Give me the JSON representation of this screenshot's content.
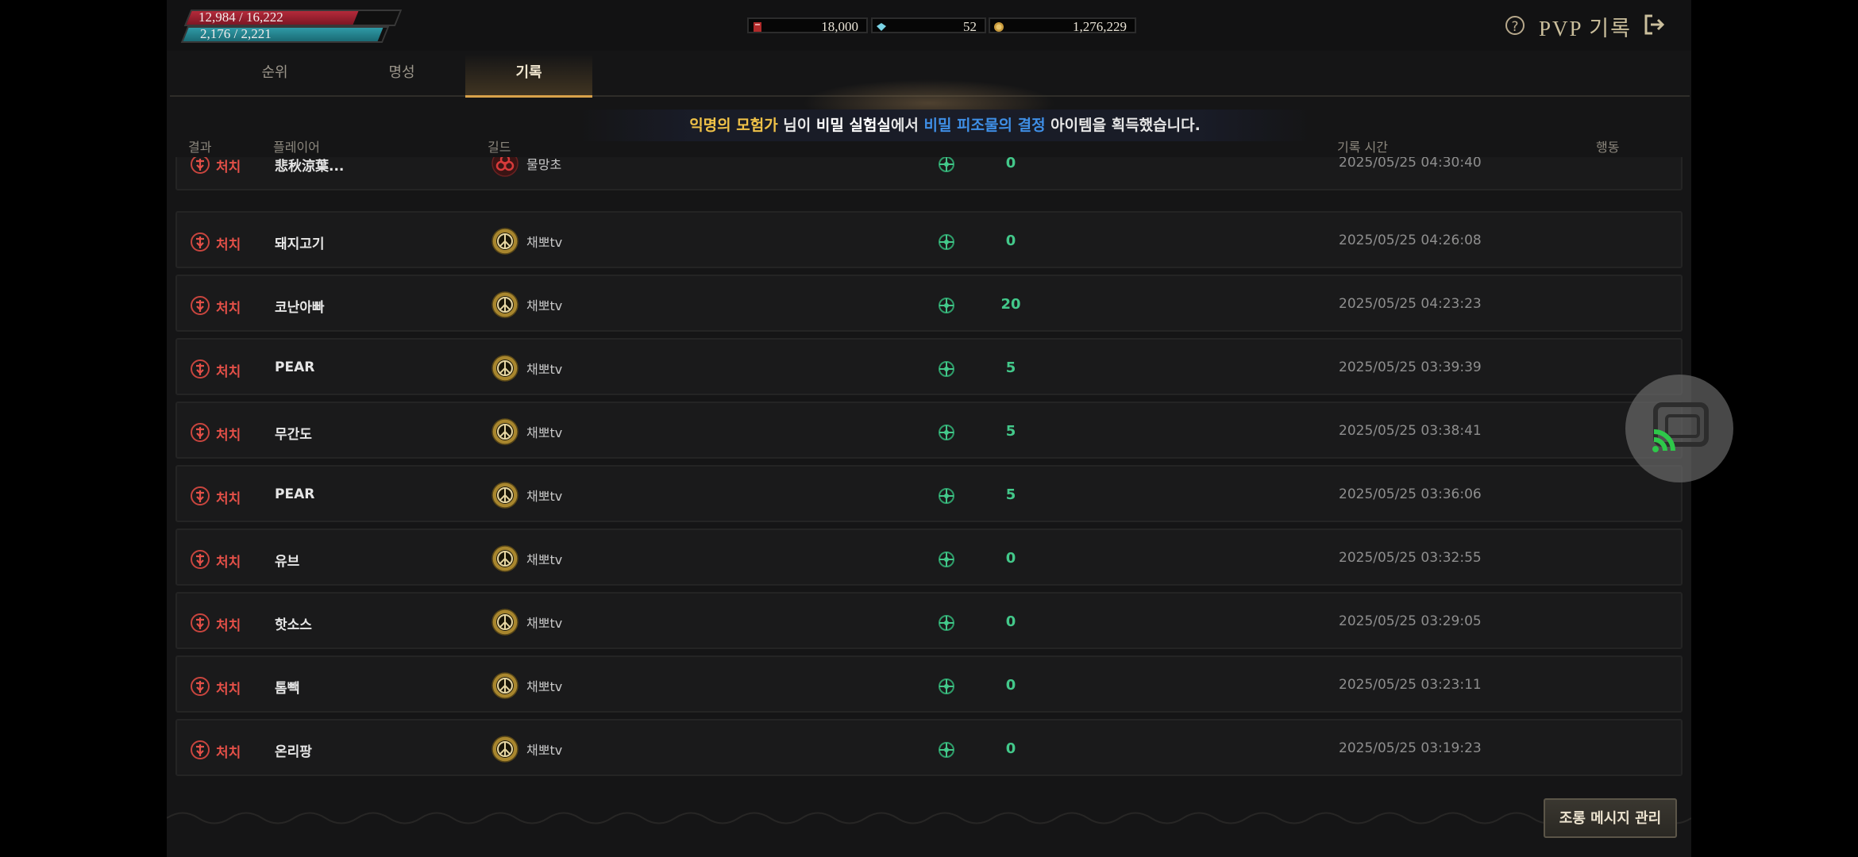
{
  "header": {
    "hp_text": "12,984 / 16,222",
    "hp_ratio": 0.8,
    "mp_text": "2,176 / 2,221",
    "mp_ratio": 0.98,
    "currencies": [
      {
        "icon": "red-ticket-icon",
        "value": "18,000"
      },
      {
        "icon": "diamond-icon",
        "value": "52"
      },
      {
        "icon": "gold-coin-icon",
        "value": "1,276,229"
      }
    ],
    "title": "PVP 기록",
    "help_label": "?"
  },
  "tabs": [
    {
      "label": "순위",
      "active": false
    },
    {
      "label": "명성",
      "active": false
    },
    {
      "label": "기록",
      "active": true
    }
  ],
  "notice": {
    "name": "익명의 모험가",
    "p1": " 님이 ",
    "place": "비밀 실험실",
    "p2": "에서 ",
    "item": "비밀 피조물의 결정",
    "p3": " 아이템을 획득했습니다."
  },
  "columns": {
    "result": "결과",
    "player": "플레이어",
    "guild": "길드",
    "time": "기록 시간",
    "action": "행동"
  },
  "rows": [
    {
      "result": "처치",
      "player": "悲秋涼葉...",
      "guild": "물망초",
      "guild_icon": "biohazard-icon",
      "score": "0",
      "time": "2025/05/25 04:30:40"
    },
    {
      "result": "처치",
      "player": "돼지고기",
      "guild": "채뽀tv",
      "guild_icon": "peace-icon",
      "score": "0",
      "time": "2025/05/25 04:26:08"
    },
    {
      "result": "처치",
      "player": "코난아빠",
      "guild": "채뽀tv",
      "guild_icon": "peace-icon",
      "score": "20",
      "time": "2025/05/25 04:23:23"
    },
    {
      "result": "처치",
      "player": "PEAR",
      "guild": "채뽀tv",
      "guild_icon": "peace-icon",
      "score": "5",
      "time": "2025/05/25 03:39:39"
    },
    {
      "result": "처치",
      "player": "무간도",
      "guild": "채뽀tv",
      "guild_icon": "peace-icon",
      "score": "5",
      "time": "2025/05/25 03:38:41"
    },
    {
      "result": "처치",
      "player": "PEAR",
      "guild": "채뽀tv",
      "guild_icon": "peace-icon",
      "score": "5",
      "time": "2025/05/25 03:36:06"
    },
    {
      "result": "처치",
      "player": "유브",
      "guild": "채뽀tv",
      "guild_icon": "peace-icon",
      "score": "0",
      "time": "2025/05/25 03:32:55"
    },
    {
      "result": "처치",
      "player": "핫소스",
      "guild": "채뽀tv",
      "guild_icon": "peace-icon",
      "score": "0",
      "time": "2025/05/25 03:29:05"
    },
    {
      "result": "처치",
      "player": "톰빽",
      "guild": "채뽀tv",
      "guild_icon": "peace-icon",
      "score": "0",
      "time": "2025/05/25 03:23:11"
    },
    {
      "result": "처치",
      "player": "온리팡",
      "guild": "채뽀tv",
      "guild_icon": "peace-icon",
      "score": "0",
      "time": "2025/05/25 03:19:23"
    }
  ],
  "taunt_button": "조롱 메시지 관리",
  "colors": {
    "accent": "#d9a24a",
    "kill_red": "#e45048",
    "score_green": "#43c88a",
    "notice_yellow": "#f0c248",
    "notice_blue": "#3f8fe6"
  }
}
